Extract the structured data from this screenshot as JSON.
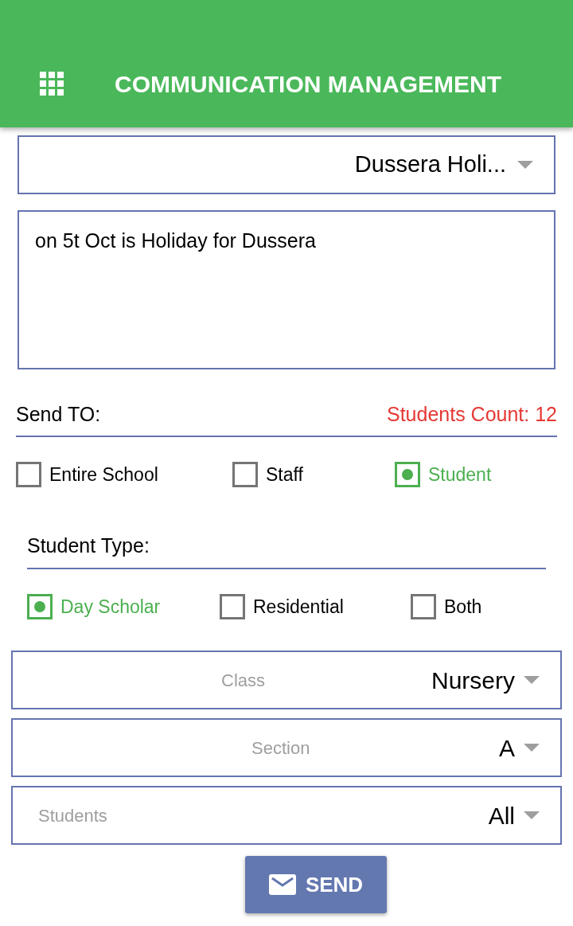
{
  "app_bar": {
    "title": "COMMUNICATION MANAGEMENT"
  },
  "template_select": {
    "value": "Dussera Holi..."
  },
  "message": {
    "value": "on 5t Oct is Holiday for Dussera"
  },
  "send_to": {
    "label": "Send TO:",
    "count": "Students Count: 12",
    "options": [
      {
        "label": "Entire School",
        "selected": false
      },
      {
        "label": "Staff",
        "selected": false
      },
      {
        "label": "Student",
        "selected": true
      }
    ]
  },
  "student_type": {
    "label": "Student Type:",
    "options": [
      {
        "label": "Day Scholar",
        "selected": true
      },
      {
        "label": "Residential",
        "selected": false
      },
      {
        "label": "Both",
        "selected": false
      }
    ]
  },
  "filters": [
    {
      "label": "Class",
      "value": "Nursery"
    },
    {
      "label": "Section",
      "value": "A"
    },
    {
      "label": "Students",
      "value": "All"
    }
  ],
  "send_button": {
    "label": "SEND"
  }
}
